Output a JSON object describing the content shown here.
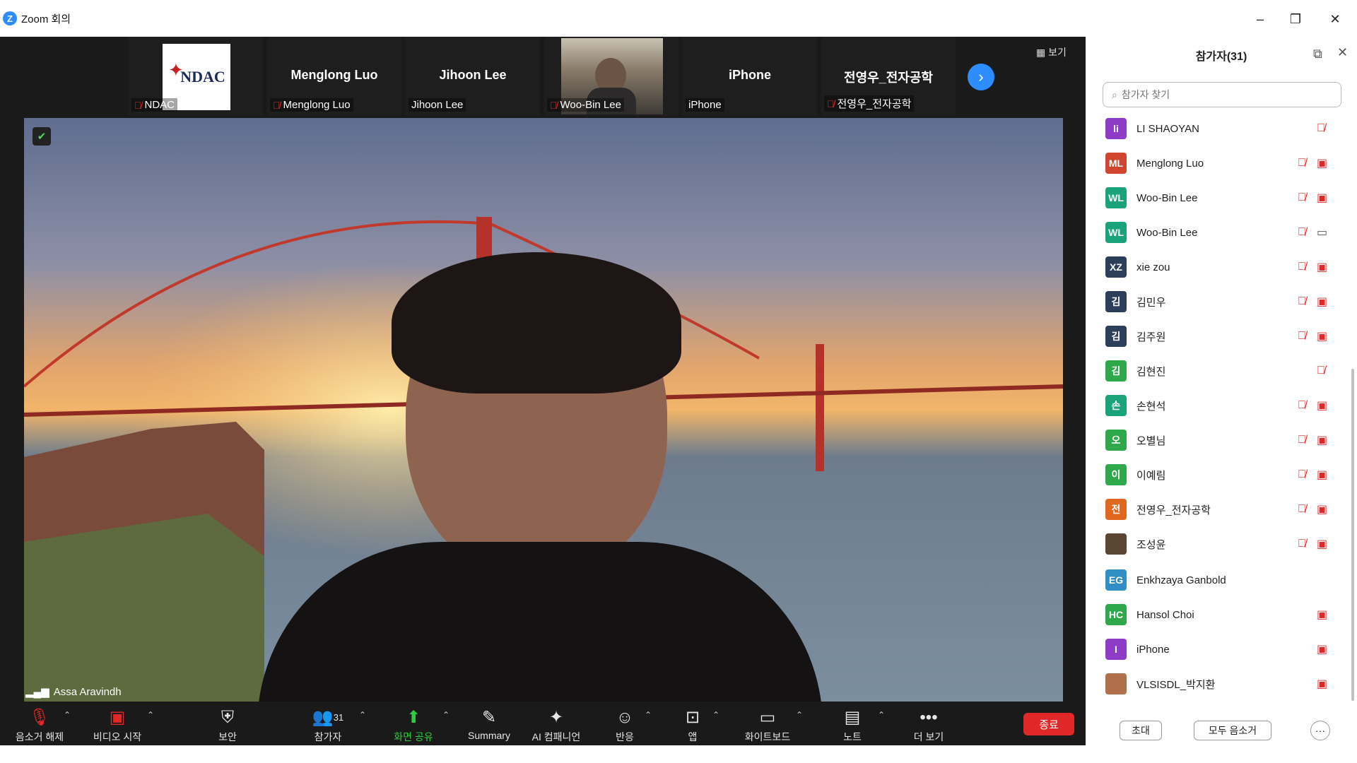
{
  "app": {
    "title": "Zoom 회의",
    "logo_letter": "Z"
  },
  "strip": {
    "view_label": "보기",
    "tiles": [
      {
        "name": "",
        "label": "NDAC",
        "muted": true,
        "logo_text": "NDAC"
      },
      {
        "name": "Menglong Luo",
        "label": "Menglong Luo",
        "muted": true
      },
      {
        "name": "Jihoon Lee",
        "label": "Jihoon Lee",
        "muted": false
      },
      {
        "name": "",
        "label": "Woo-Bin Lee",
        "muted": true
      },
      {
        "name": "iPhone",
        "label": "iPhone",
        "muted": false
      },
      {
        "name": "전영우_전자공학",
        "label": "전영우_전자공학",
        "muted": true
      }
    ]
  },
  "main_video": {
    "speaker": "Assa Aravindh"
  },
  "toolbar": {
    "unmute": "음소거 해제",
    "start_video": "비디오 시작",
    "security": "보안",
    "participants": "참가자",
    "participant_count": "31",
    "share_screen": "화면 공유",
    "summary": "Summary",
    "ai_companion": "AI 컴패니언",
    "reactions": "반응",
    "apps": "앱",
    "whiteboard": "화이트보드",
    "notes": "노트",
    "more": "더 보기",
    "end": "종료"
  },
  "panel": {
    "title": "참가자(31)",
    "search_placeholder": "참가자 찾기",
    "participants": [
      {
        "initials": "li",
        "name": "LI SHAOYAN",
        "color": "#8e3bc7",
        "mic_off": true,
        "cam": "none"
      },
      {
        "initials": "ML",
        "name": "Menglong Luo",
        "color": "#d0452e",
        "mic_off": true,
        "cam": "off"
      },
      {
        "initials": "WL",
        "name": "Woo-Bin Lee",
        "color": "#1aa37a",
        "mic_off": true,
        "cam": "off"
      },
      {
        "initials": "WL",
        "name": "Woo-Bin Lee",
        "color": "#1aa37a",
        "mic_off": true,
        "cam": "on"
      },
      {
        "initials": "XZ",
        "name": "xie zou",
        "color": "#2c3e5a",
        "mic_off": true,
        "cam": "off"
      },
      {
        "initials": "김",
        "name": "김민우",
        "color": "#2c3e5a",
        "mic_off": true,
        "cam": "off"
      },
      {
        "initials": "김",
        "name": "김주원",
        "color": "#2c3e5a",
        "mic_off": true,
        "cam": "off"
      },
      {
        "initials": "김",
        "name": "김현진",
        "color": "#2ea84a",
        "mic_off": true,
        "cam": "none"
      },
      {
        "initials": "손",
        "name": "손현석",
        "color": "#1aa37a",
        "mic_off": true,
        "cam": "off"
      },
      {
        "initials": "오",
        "name": "오별님",
        "color": "#2ea84a",
        "mic_off": true,
        "cam": "off"
      },
      {
        "initials": "이",
        "name": "이예림",
        "color": "#2ea84a",
        "mic_off": true,
        "cam": "off"
      },
      {
        "initials": "전",
        "name": "전영우_전자공학",
        "color": "#e0681e",
        "mic_off": true,
        "cam": "off"
      },
      {
        "initials": "",
        "name": "조성윤",
        "color": "#5a4632",
        "mic_off": true,
        "cam": "off"
      },
      {
        "initials": "EG",
        "name": "Enkhzaya Ganbold",
        "color": "#2f8fc4",
        "mic_off": false,
        "cam": "none"
      },
      {
        "initials": "HC",
        "name": "Hansol Choi",
        "color": "#2ea84a",
        "mic_off": false,
        "cam": "off"
      },
      {
        "initials": "I",
        "name": "iPhone",
        "color": "#8e3bc7",
        "mic_off": false,
        "cam": "off"
      },
      {
        "initials": "",
        "name": "VLSISDL_박지환",
        "color": "#b0704a",
        "mic_off": false,
        "cam": "off"
      }
    ],
    "invite": "초대",
    "mute_all": "모두 음소거",
    "more": "···"
  }
}
